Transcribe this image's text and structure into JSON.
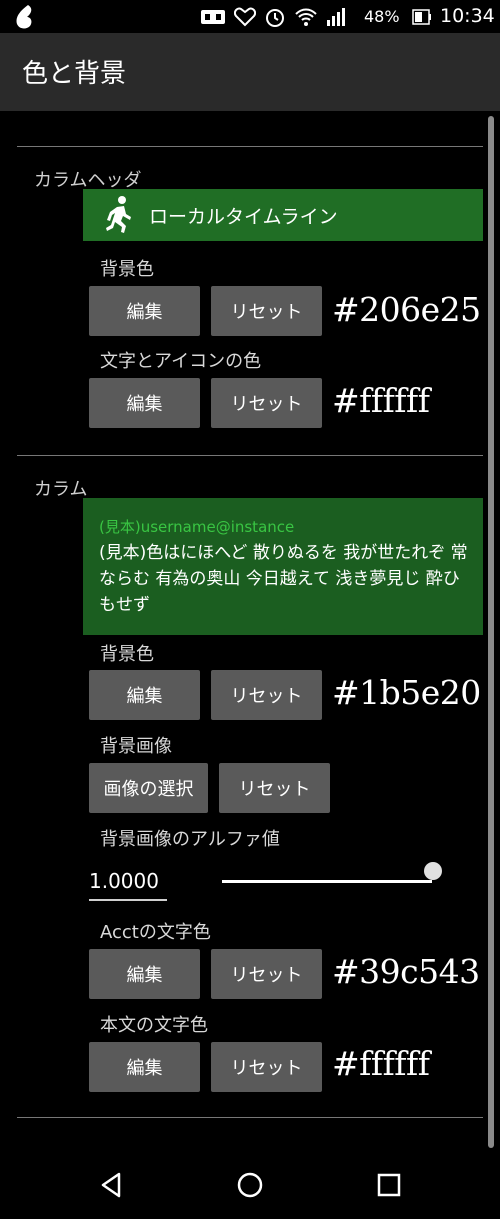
{
  "status_bar": {
    "battery_percent": "48%",
    "time": "10:34",
    "icons": [
      "app-drop-icon",
      "vr-icon",
      "heart-icon",
      "alarm-icon",
      "wifi-icon",
      "signal-icon",
      "battery-icon"
    ]
  },
  "app_bar": {
    "title": "色と背景"
  },
  "column_header": {
    "section_label": "カラムヘッダ",
    "preview_label": "ローカルタイムライン",
    "preview_icon": "running-person-icon",
    "background_color": {
      "label": "背景色",
      "edit": "編集",
      "reset": "リセット",
      "value": "#206e25"
    },
    "text_icon_color": {
      "label": "文字とアイコンの色",
      "edit": "編集",
      "reset": "リセット",
      "value": "#ffffff"
    }
  },
  "column": {
    "section_label": "カラム",
    "preview_acct": "(見本)username@instance",
    "preview_body": "(見本)色はにほへど 散りぬるを 我が世たれぞ 常ならむ 有為の奥山 今日越えて 浅き夢見じ 酔ひもせず",
    "background_color": {
      "label": "背景色",
      "edit": "編集",
      "reset": "リセット",
      "value": "#1b5e20"
    },
    "background_image": {
      "label": "背景画像",
      "select": "画像の選択",
      "reset": "リセット"
    },
    "background_alpha": {
      "label": "背景画像のアルファ値",
      "value": "1.0000",
      "slider_fraction": 1.0
    },
    "acct_color": {
      "label": "Acctの文字色",
      "edit": "編集",
      "reset": "リセット",
      "value": "#39c543"
    },
    "body_color": {
      "label": "本文の文字色",
      "edit": "編集",
      "reset": "リセット",
      "value": "#ffffff"
    }
  },
  "colors": {
    "header_bg": "#206e25",
    "column_bg": "#1b5e20",
    "acct_text": "#39c543",
    "app_bar": "#2a2a2a",
    "button": "#5a5a5a"
  },
  "nav_bar": {
    "icons": [
      "back-icon",
      "home-icon",
      "recents-icon"
    ]
  }
}
